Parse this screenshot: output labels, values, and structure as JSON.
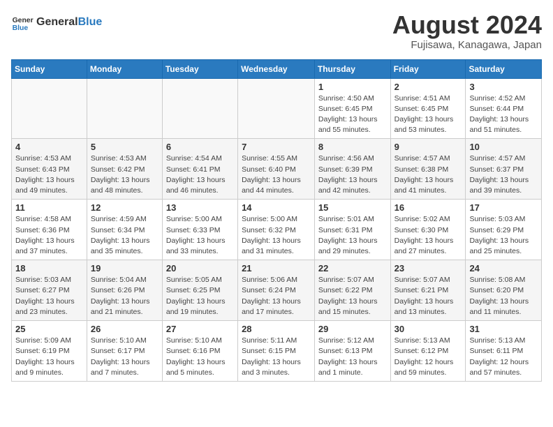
{
  "header": {
    "logo_general": "General",
    "logo_blue": "Blue",
    "month_year": "August 2024",
    "location": "Fujisawa, Kanagawa, Japan"
  },
  "days_of_week": [
    "Sunday",
    "Monday",
    "Tuesday",
    "Wednesday",
    "Thursday",
    "Friday",
    "Saturday"
  ],
  "weeks": [
    [
      {
        "day": "",
        "info": ""
      },
      {
        "day": "",
        "info": ""
      },
      {
        "day": "",
        "info": ""
      },
      {
        "day": "",
        "info": ""
      },
      {
        "day": "1",
        "info": "Sunrise: 4:50 AM\nSunset: 6:45 PM\nDaylight: 13 hours\nand 55 minutes."
      },
      {
        "day": "2",
        "info": "Sunrise: 4:51 AM\nSunset: 6:45 PM\nDaylight: 13 hours\nand 53 minutes."
      },
      {
        "day": "3",
        "info": "Sunrise: 4:52 AM\nSunset: 6:44 PM\nDaylight: 13 hours\nand 51 minutes."
      }
    ],
    [
      {
        "day": "4",
        "info": "Sunrise: 4:53 AM\nSunset: 6:43 PM\nDaylight: 13 hours\nand 49 minutes."
      },
      {
        "day": "5",
        "info": "Sunrise: 4:53 AM\nSunset: 6:42 PM\nDaylight: 13 hours\nand 48 minutes."
      },
      {
        "day": "6",
        "info": "Sunrise: 4:54 AM\nSunset: 6:41 PM\nDaylight: 13 hours\nand 46 minutes."
      },
      {
        "day": "7",
        "info": "Sunrise: 4:55 AM\nSunset: 6:40 PM\nDaylight: 13 hours\nand 44 minutes."
      },
      {
        "day": "8",
        "info": "Sunrise: 4:56 AM\nSunset: 6:39 PM\nDaylight: 13 hours\nand 42 minutes."
      },
      {
        "day": "9",
        "info": "Sunrise: 4:57 AM\nSunset: 6:38 PM\nDaylight: 13 hours\nand 41 minutes."
      },
      {
        "day": "10",
        "info": "Sunrise: 4:57 AM\nSunset: 6:37 PM\nDaylight: 13 hours\nand 39 minutes."
      }
    ],
    [
      {
        "day": "11",
        "info": "Sunrise: 4:58 AM\nSunset: 6:36 PM\nDaylight: 13 hours\nand 37 minutes."
      },
      {
        "day": "12",
        "info": "Sunrise: 4:59 AM\nSunset: 6:34 PM\nDaylight: 13 hours\nand 35 minutes."
      },
      {
        "day": "13",
        "info": "Sunrise: 5:00 AM\nSunset: 6:33 PM\nDaylight: 13 hours\nand 33 minutes."
      },
      {
        "day": "14",
        "info": "Sunrise: 5:00 AM\nSunset: 6:32 PM\nDaylight: 13 hours\nand 31 minutes."
      },
      {
        "day": "15",
        "info": "Sunrise: 5:01 AM\nSunset: 6:31 PM\nDaylight: 13 hours\nand 29 minutes."
      },
      {
        "day": "16",
        "info": "Sunrise: 5:02 AM\nSunset: 6:30 PM\nDaylight: 13 hours\nand 27 minutes."
      },
      {
        "day": "17",
        "info": "Sunrise: 5:03 AM\nSunset: 6:29 PM\nDaylight: 13 hours\nand 25 minutes."
      }
    ],
    [
      {
        "day": "18",
        "info": "Sunrise: 5:03 AM\nSunset: 6:27 PM\nDaylight: 13 hours\nand 23 minutes."
      },
      {
        "day": "19",
        "info": "Sunrise: 5:04 AM\nSunset: 6:26 PM\nDaylight: 13 hours\nand 21 minutes."
      },
      {
        "day": "20",
        "info": "Sunrise: 5:05 AM\nSunset: 6:25 PM\nDaylight: 13 hours\nand 19 minutes."
      },
      {
        "day": "21",
        "info": "Sunrise: 5:06 AM\nSunset: 6:24 PM\nDaylight: 13 hours\nand 17 minutes."
      },
      {
        "day": "22",
        "info": "Sunrise: 5:07 AM\nSunset: 6:22 PM\nDaylight: 13 hours\nand 15 minutes."
      },
      {
        "day": "23",
        "info": "Sunrise: 5:07 AM\nSunset: 6:21 PM\nDaylight: 13 hours\nand 13 minutes."
      },
      {
        "day": "24",
        "info": "Sunrise: 5:08 AM\nSunset: 6:20 PM\nDaylight: 13 hours\nand 11 minutes."
      }
    ],
    [
      {
        "day": "25",
        "info": "Sunrise: 5:09 AM\nSunset: 6:19 PM\nDaylight: 13 hours\nand 9 minutes."
      },
      {
        "day": "26",
        "info": "Sunrise: 5:10 AM\nSunset: 6:17 PM\nDaylight: 13 hours\nand 7 minutes."
      },
      {
        "day": "27",
        "info": "Sunrise: 5:10 AM\nSunset: 6:16 PM\nDaylight: 13 hours\nand 5 minutes."
      },
      {
        "day": "28",
        "info": "Sunrise: 5:11 AM\nSunset: 6:15 PM\nDaylight: 13 hours\nand 3 minutes."
      },
      {
        "day": "29",
        "info": "Sunrise: 5:12 AM\nSunset: 6:13 PM\nDaylight: 13 hours\nand 1 minute."
      },
      {
        "day": "30",
        "info": "Sunrise: 5:13 AM\nSunset: 6:12 PM\nDaylight: 12 hours\nand 59 minutes."
      },
      {
        "day": "31",
        "info": "Sunrise: 5:13 AM\nSunset: 6:11 PM\nDaylight: 12 hours\nand 57 minutes."
      }
    ]
  ]
}
